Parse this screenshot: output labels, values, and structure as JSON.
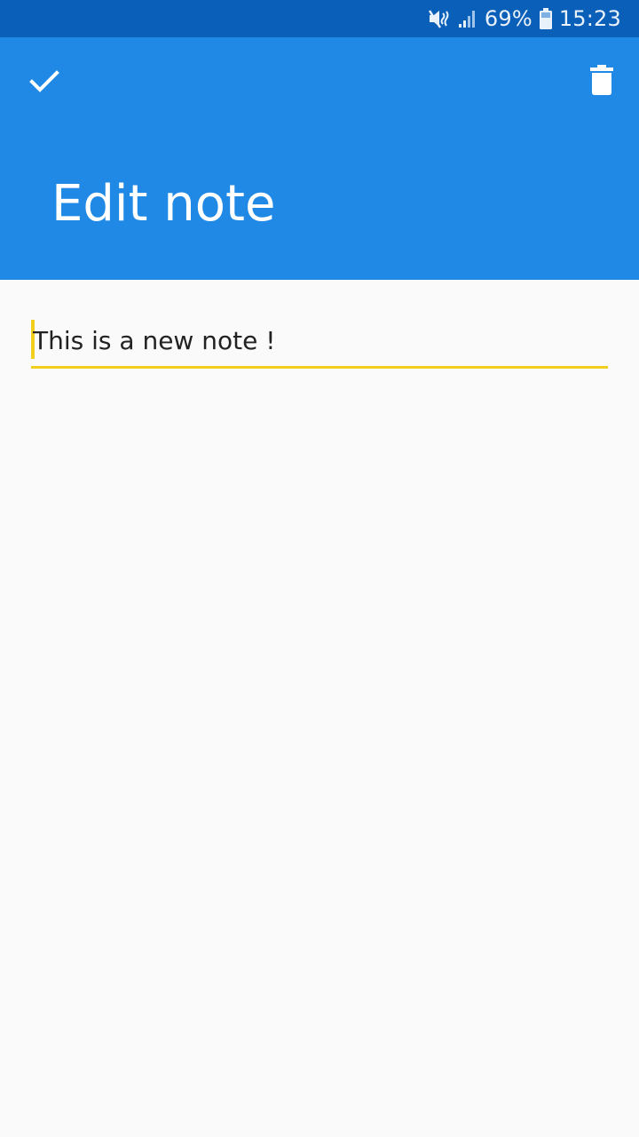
{
  "status_bar": {
    "battery_percent": "69%",
    "time": "15:23",
    "icons": [
      "mute-icon",
      "signal-icon",
      "battery-icon"
    ],
    "background_color": "#0a5fb8"
  },
  "app_bar": {
    "title": "Edit note",
    "confirm_icon": "check-icon",
    "delete_icon": "trash-icon",
    "background_color": "#1f89e5"
  },
  "editor": {
    "note_text": "This is a new note !",
    "accent_color": "#f2cf1c"
  }
}
